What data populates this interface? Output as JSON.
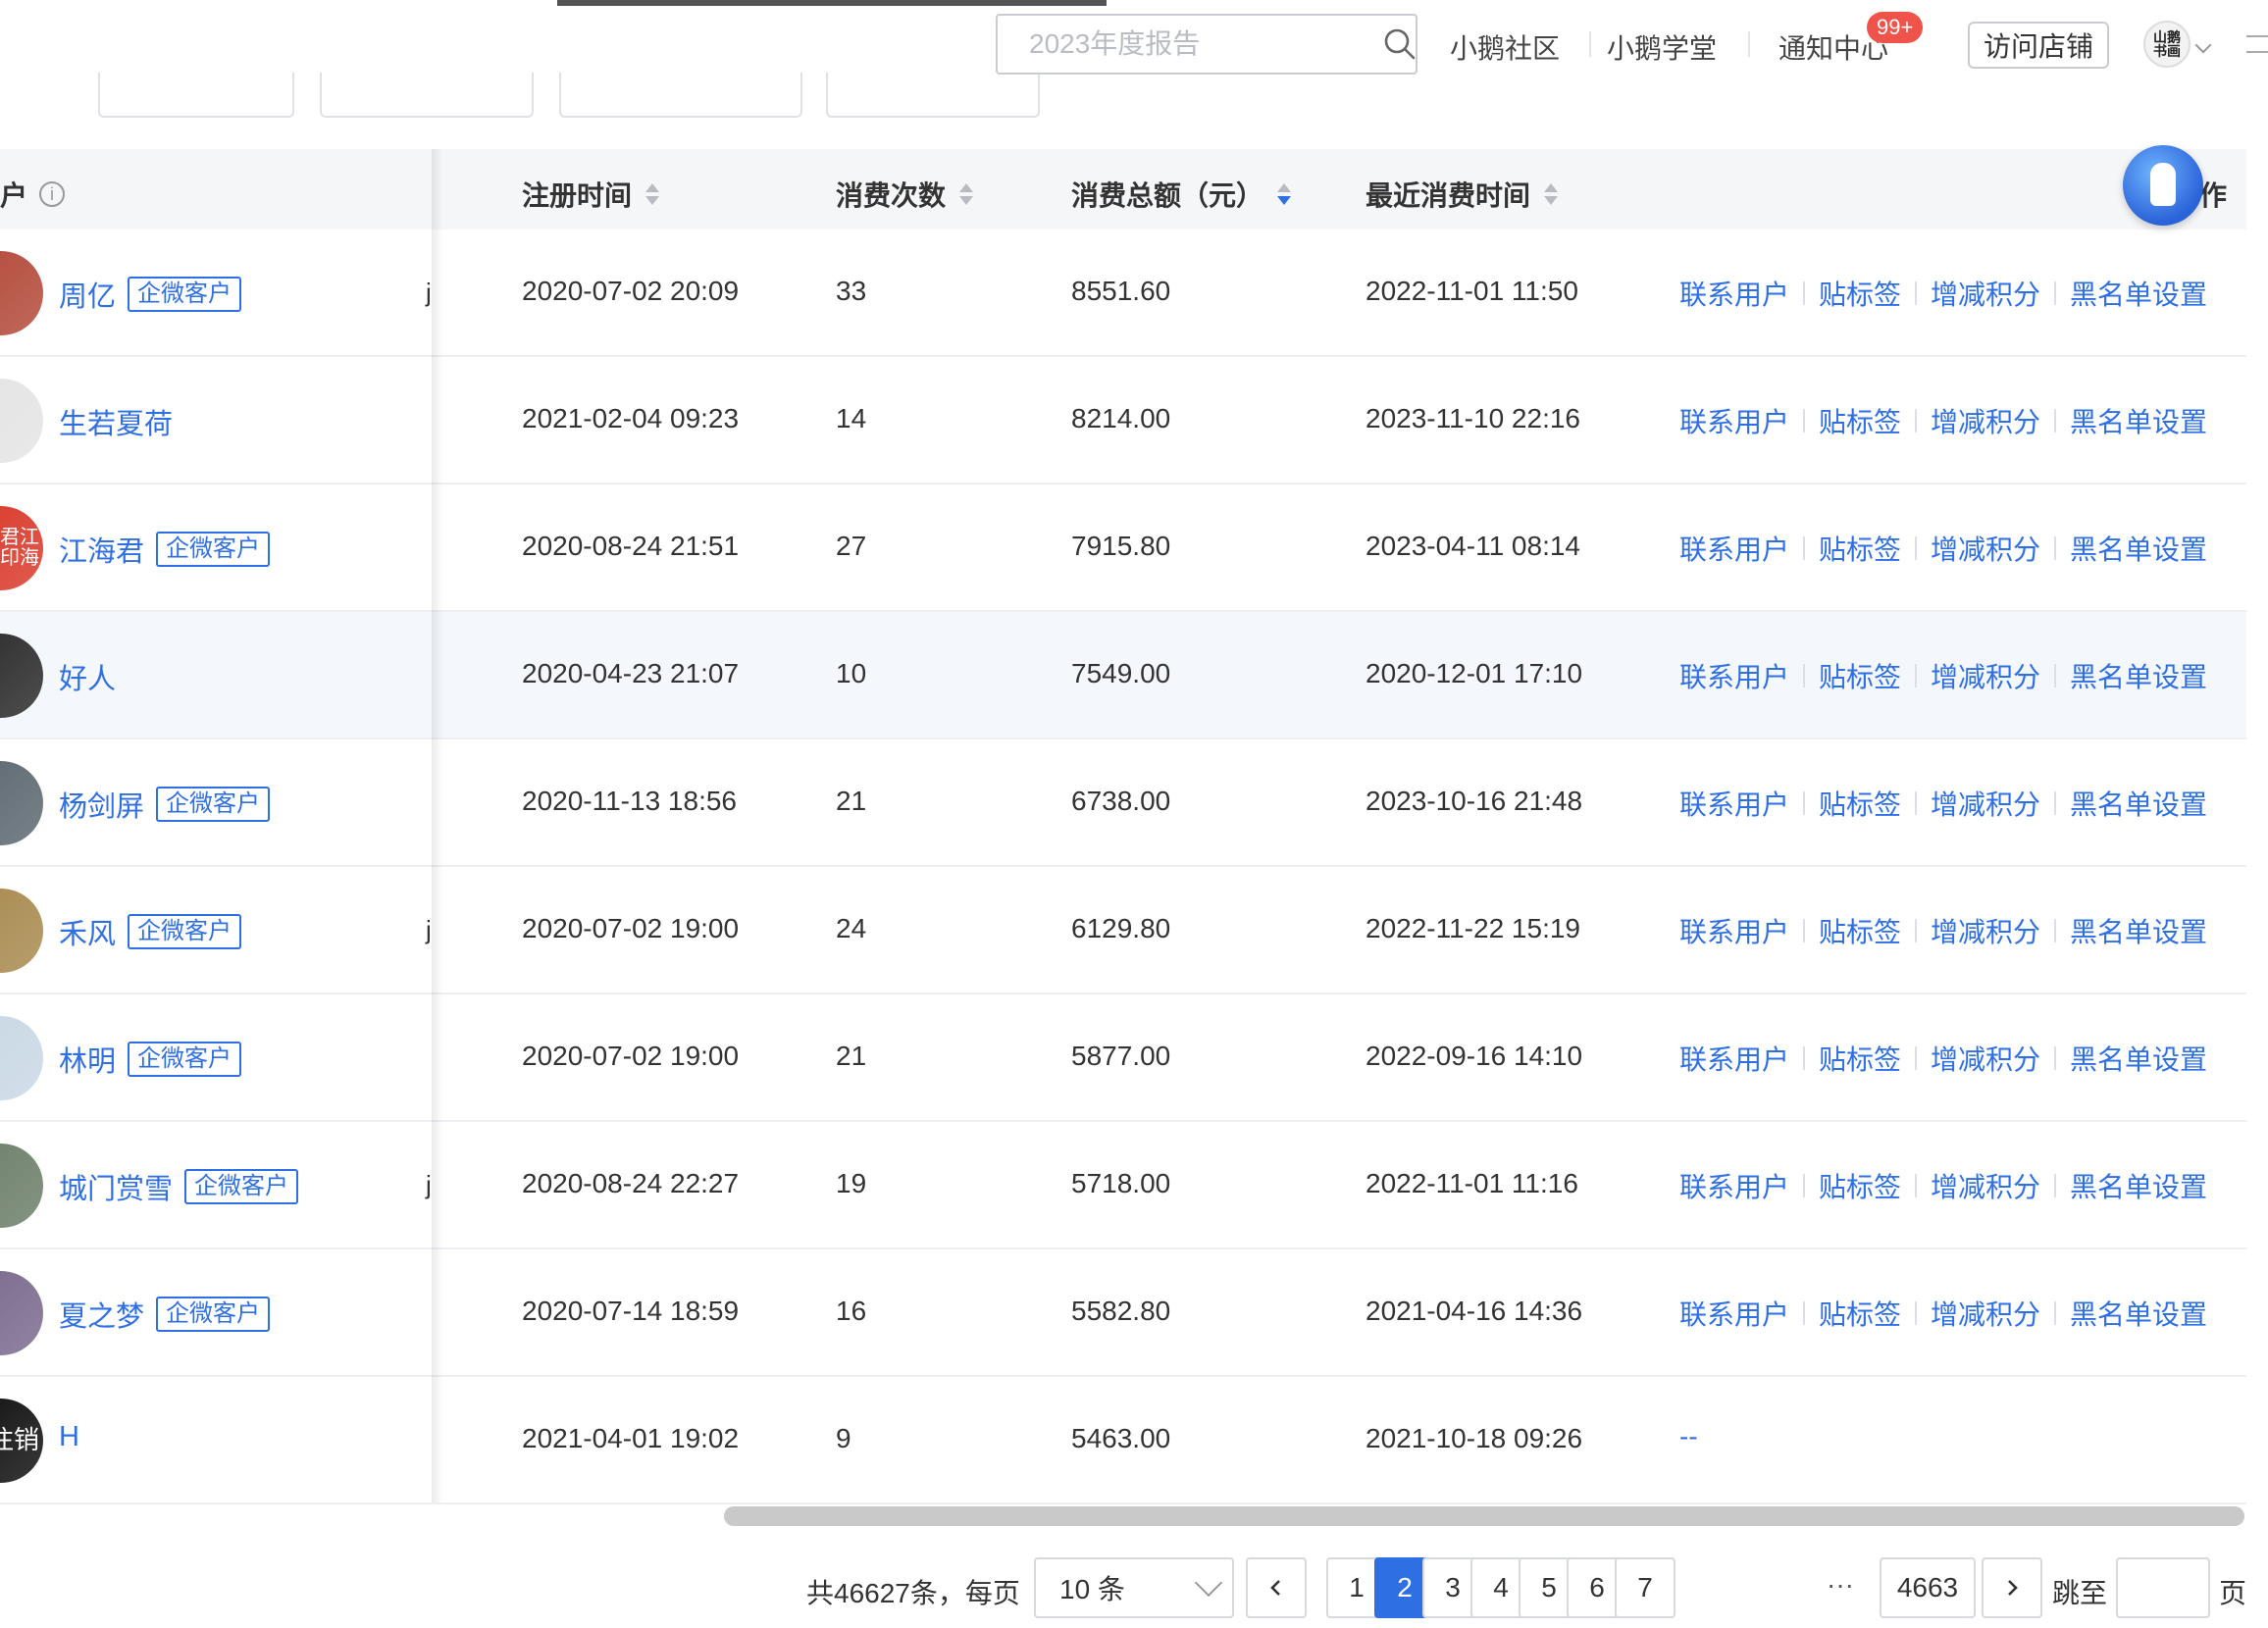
{
  "header": {
    "search": {
      "placeholder": "2023年度报告"
    },
    "nav": [
      "小鹅社区",
      "小鹅学堂",
      "通知中心"
    ],
    "notify_badge": "99+",
    "visit_store": "访问店铺",
    "avatar_text": "山鹅\n书画"
  },
  "table": {
    "columns": {
      "user_partial": "户",
      "register_time": "注册时间",
      "consume_count": "消费次数",
      "consume_total": "消费总额（元）",
      "last_consume_time": "最近消费时间",
      "action_partial": "作"
    },
    "tag_label": "企微客户",
    "actions": [
      "联系用户",
      "贴标签",
      "增减积分",
      "黑名单设置"
    ],
    "rows": [
      {
        "name": "周亿",
        "tag": true,
        "register": "2020-07-02 20:09",
        "count": "33",
        "total": "8551.60",
        "last": "2022-11-01 11:50",
        "actions": true,
        "avatar_color": "#b34a3a"
      },
      {
        "name": "生若夏荷",
        "tag": false,
        "register": "2021-02-04 09:23",
        "count": "14",
        "total": "8214.00",
        "last": "2023-11-10 22:16",
        "actions": true,
        "avatar_color": "#e4e4e4"
      },
      {
        "name": "江海君",
        "tag": true,
        "register": "2020-08-24 21:51",
        "count": "27",
        "total": "7915.80",
        "last": "2023-04-11 08:14",
        "actions": true,
        "avatar_color": "#d93a2b",
        "avatar_text": "君江\n印海"
      },
      {
        "name": "好人",
        "tag": false,
        "register": "2020-04-23 21:07",
        "count": "10",
        "total": "7549.00",
        "last": "2020-12-01 17:10",
        "actions": true,
        "avatar_color": "#2b2b2b"
      },
      {
        "name": "杨剑屏",
        "tag": true,
        "register": "2020-11-13 18:56",
        "count": "21",
        "total": "6738.00",
        "last": "2023-10-16 21:48",
        "actions": true,
        "avatar_color": "#5d6870"
      },
      {
        "name": "禾风",
        "tag": true,
        "register": "2020-07-02 19:00",
        "count": "24",
        "total": "6129.80",
        "last": "2022-11-22 15:19",
        "actions": true,
        "avatar_color": "#a88a4f"
      },
      {
        "name": "林明",
        "tag": true,
        "register": "2020-07-02 19:00",
        "count": "21",
        "total": "5877.00",
        "last": "2022-09-16 14:10",
        "actions": true,
        "avatar_color": "#c9d8e4"
      },
      {
        "name": "城门赏雪",
        "tag": true,
        "register": "2020-08-24 22:27",
        "count": "19",
        "total": "5718.00",
        "last": "2022-11-01 11:16",
        "actions": true,
        "avatar_color": "#6d7f6a"
      },
      {
        "name": "夏之梦",
        "tag": true,
        "register": "2020-07-14 18:59",
        "count": "16",
        "total": "5582.80",
        "last": "2021-04-16 14:36",
        "actions": true,
        "avatar_color": "#7a6a8e"
      },
      {
        "name": "H",
        "tag": false,
        "register": "2021-04-01 19:02",
        "count": "9",
        "total": "5463.00",
        "last": "2021-10-18 09:26",
        "actions": false,
        "no_action_text": "--",
        "avatar_color": "#111111",
        "avatar_text": "注销"
      }
    ],
    "cut_char": "j"
  },
  "pagination": {
    "total": "共46627条，每页",
    "page_size": "10 条",
    "pages": [
      "1",
      "2",
      "3",
      "4",
      "5",
      "6",
      "7"
    ],
    "current": "2",
    "ellipsis": "···",
    "last_page": "4663",
    "jump_label": "跳至",
    "page_suffix": "页"
  },
  "colors": {
    "accent": "#2f6fe4",
    "badge": "#f0534a",
    "header_bg": "#f5f6f8",
    "hover_row": "#f4f7fc"
  }
}
